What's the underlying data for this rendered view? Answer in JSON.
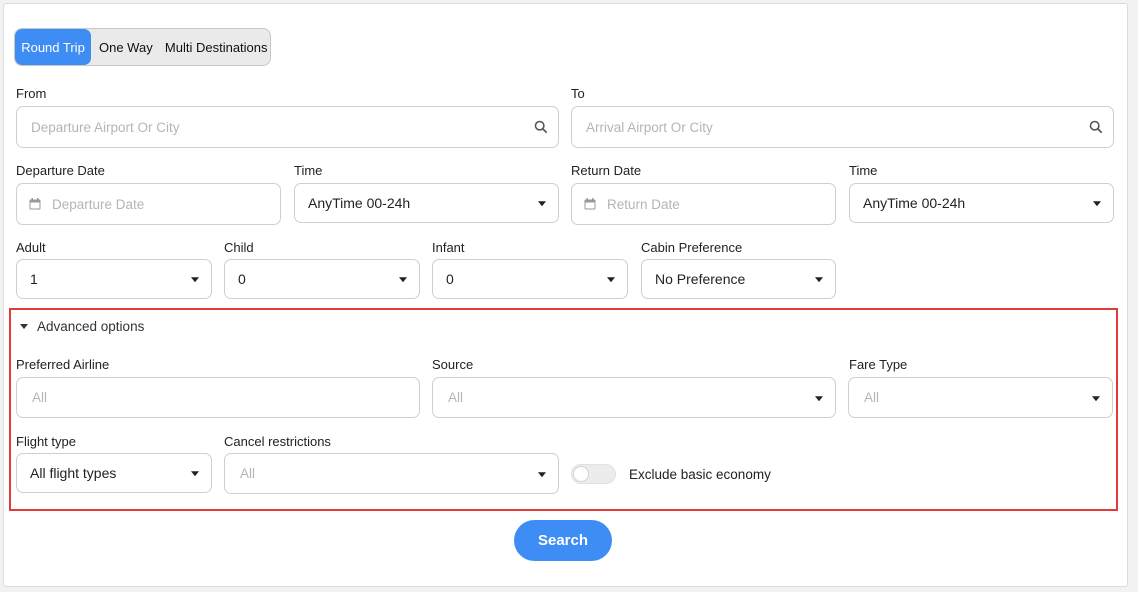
{
  "trip_types": {
    "round_trip": "Round Trip",
    "one_way": "One Way",
    "multi": "Multi Destinations",
    "selected": "Round Trip"
  },
  "from": {
    "label": "From",
    "placeholder": "Departure Airport Or City"
  },
  "to": {
    "label": "To",
    "placeholder": "Arrival Airport Or City"
  },
  "departure_date": {
    "label": "Departure Date",
    "placeholder": "Departure Date"
  },
  "departure_time": {
    "label": "Time",
    "value": "AnyTime 00-24h"
  },
  "return_date": {
    "label": "Return Date",
    "placeholder": "Return Date"
  },
  "return_time": {
    "label": "Time",
    "value": "AnyTime 00-24h"
  },
  "adult": {
    "label": "Adult",
    "value": "1"
  },
  "child": {
    "label": "Child",
    "value": "0"
  },
  "infant": {
    "label": "Infant",
    "value": "0"
  },
  "cabin": {
    "label": "Cabin Preference",
    "value": "No Preference"
  },
  "advanced": {
    "toggle_label": "Advanced options",
    "preferred_airline": {
      "label": "Preferred Airline",
      "placeholder": "All"
    },
    "source": {
      "label": "Source",
      "placeholder": "All"
    },
    "fare_type": {
      "label": "Fare Type",
      "placeholder": "All"
    },
    "flight_type": {
      "label": "Flight type",
      "value": "All flight types"
    },
    "cancel_restrictions": {
      "label": "Cancel restrictions",
      "placeholder": "All"
    },
    "exclude_basic_economy": {
      "label": "Exclude basic economy",
      "enabled": false
    }
  },
  "search_button": "Search",
  "colors": {
    "accent": "#3d8df5",
    "highlight_border": "#e03a3a"
  }
}
